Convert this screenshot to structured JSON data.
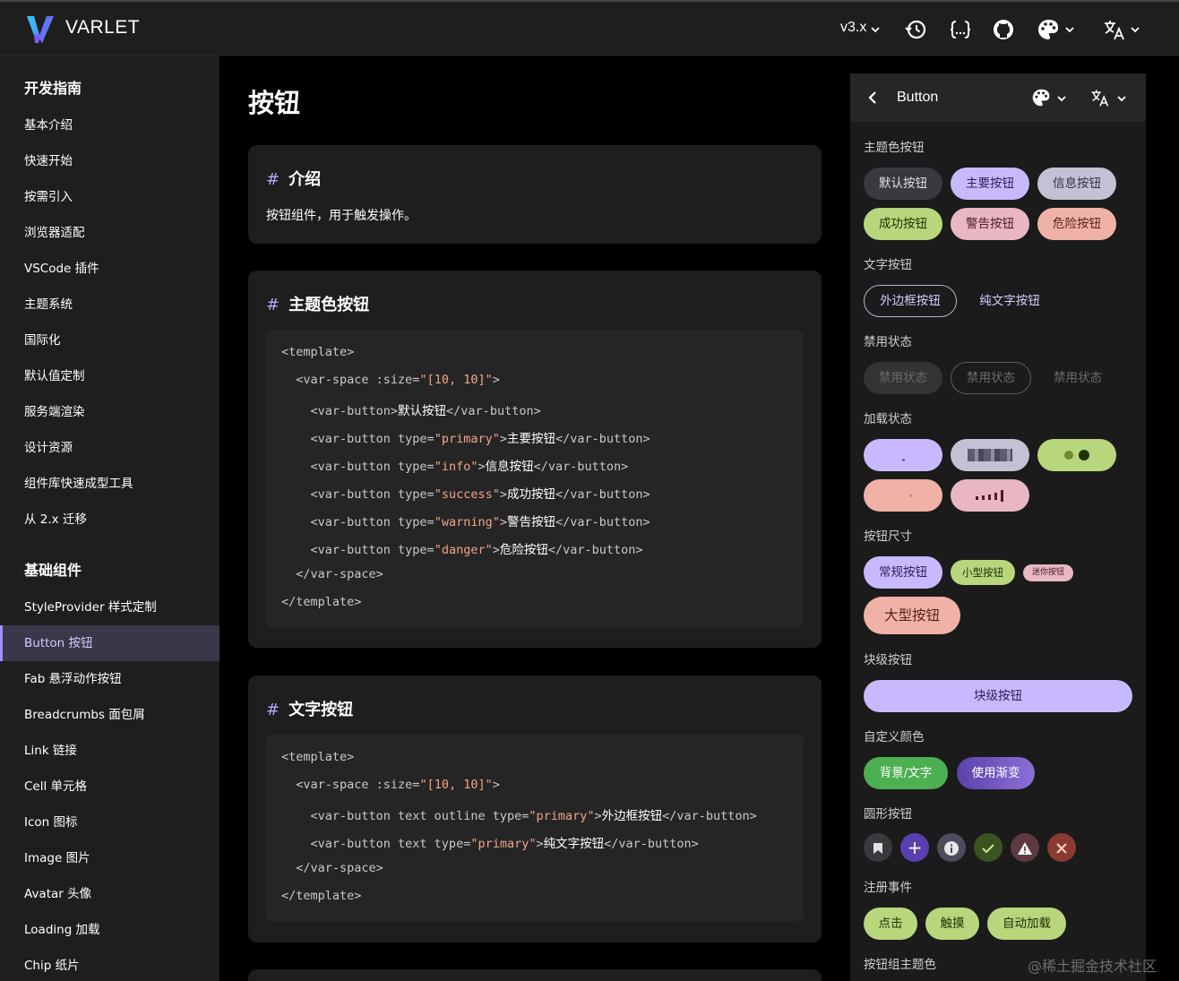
{
  "header": {
    "brand": "VARLET",
    "version": "v3.x",
    "icons": [
      "history-icon",
      "code-braces-icon",
      "github-icon",
      "palette-icon",
      "translate-icon"
    ]
  },
  "sidebar": {
    "category_guide": "开发指南",
    "guide_items": [
      "基本介绍",
      "快速开始",
      "按需引入",
      "浏览器适配",
      "VSCode 插件",
      "主题系统",
      "国际化",
      "默认值定制",
      "服务端渲染",
      "设计资源",
      "组件库快速成型工具",
      "从 2.x 迁移"
    ],
    "category_basic": "基础组件",
    "basic_items": [
      "StyleProvider 样式定制",
      "Button 按钮",
      "Fab 悬浮动作按钮",
      "Breadcrumbs 面包屑",
      "Link 链接",
      "Cell 单元格",
      "Icon 图标",
      "Image 图片",
      "Avatar 头像",
      "Loading 加载",
      "Chip 纸片"
    ],
    "active": "Button 按钮"
  },
  "main": {
    "title": "按钮",
    "intro": {
      "title": "介绍",
      "text": "按钮组件，用于触发操作。"
    },
    "theme": {
      "title": "主题色按钮",
      "code": {
        "l1": "<template>",
        "l2a": "  <var-space :size=",
        "l2s": "\"[10, 10]\"",
        "l2b": ">",
        "l3a": "    <var-button>",
        "l3t": "默认按钮",
        "l3b": "</var-button>",
        "l4a": "    <var-button type=",
        "l4s": "\"primary\"",
        "l4b": ">",
        "l4t": "主要按钮",
        "l4c": "</var-button>",
        "l5a": "    <var-button type=",
        "l5s": "\"info\"",
        "l5b": ">",
        "l5t": "信息按钮",
        "l5c": "</var-button>",
        "l6a": "    <var-button type=",
        "l6s": "\"success\"",
        "l6b": ">",
        "l6t": "成功按钮",
        "l6c": "</var-button>",
        "l7a": "    <var-button type=",
        "l7s": "\"warning\"",
        "l7b": ">",
        "l7t": "警告按钮",
        "l7c": "</var-button>",
        "l8a": "    <var-button type=",
        "l8s": "\"danger\"",
        "l8b": ">",
        "l8t": "危险按钮",
        "l8c": "</var-button>",
        "l9": "  </var-space>",
        "l10": "</template>"
      }
    },
    "text_buttons": {
      "title": "文字按钮",
      "code": {
        "l1": "<template>",
        "l2a": "  <var-space :size=",
        "l2s": "\"[10, 10]\"",
        "l2b": ">",
        "l3a": "    <var-button text outline type=",
        "l3s": "\"primary\"",
        "l3b": ">",
        "l3t": "外边框按钮",
        "l3c": "</var-button>",
        "l4a": "    <var-button text type=",
        "l4s": "\"primary\"",
        "l4b": ">",
        "l4t": "纯文字按钮",
        "l4c": "</var-button>",
        "l5": "  </var-space>",
        "l6": "</template>"
      }
    }
  },
  "preview": {
    "title": "Button",
    "sections": {
      "theme": "主题色按钮",
      "text": "文字按钮",
      "disabled": "禁用状态",
      "loading": "加载状态",
      "size": "按钮尺寸",
      "block": "块级按钮",
      "custom": "自定义颜色",
      "round": "圆形按钮",
      "events": "注册事件",
      "group": "按钮组主题色"
    },
    "theme_buttons": [
      "默认按钮",
      "主要按钮",
      "信息按钮",
      "成功按钮",
      "警告按钮",
      "危险按钮"
    ],
    "text_buttons": [
      "外边框按钮",
      "纯文字按钮"
    ],
    "disabled_buttons": [
      "禁用状态",
      "禁用状态",
      "禁用状态"
    ],
    "size_buttons": [
      "常规按钮",
      "小型按钮",
      "迷你按钮",
      "大型按钮"
    ],
    "block_button": "块级按钮",
    "custom_buttons": [
      "背景/文字",
      "使用渐变"
    ],
    "round_icons": [
      "bookmark-icon",
      "plus-icon",
      "info-icon",
      "check-icon",
      "warning-icon",
      "close-icon"
    ],
    "event_buttons": [
      "点击",
      "触摸",
      "自动加载"
    ]
  },
  "colors": {
    "primary": "#c8b9ff",
    "info": "#c3c1d3",
    "success": "#b8d67c",
    "warning": "#e8b7c2",
    "danger": "#f0b2a6",
    "default": "#3b3840"
  },
  "watermark": "@稀土掘金技术社区"
}
